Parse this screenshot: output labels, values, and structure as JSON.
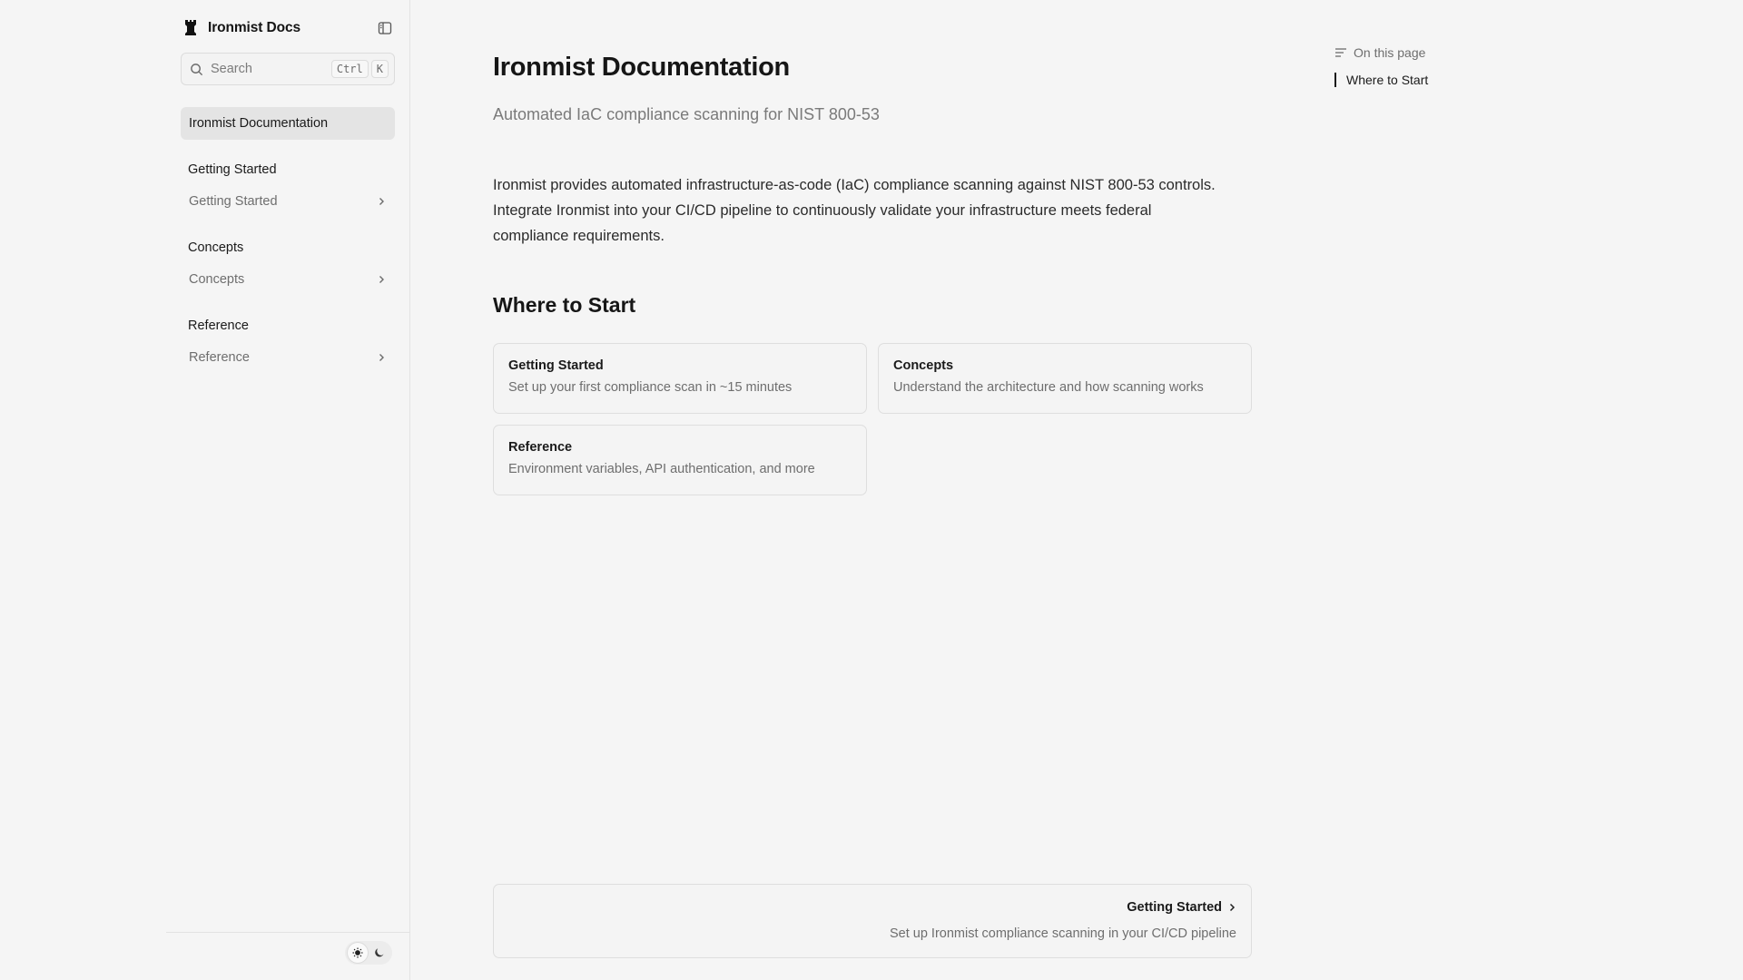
{
  "sidebar": {
    "site_title": "Ironmist Docs",
    "search": {
      "placeholder": "Search",
      "shortcut_ctrl": "Ctrl",
      "shortcut_key": "K"
    },
    "active_item": "Ironmist Documentation",
    "sections": [
      {
        "heading": "Getting Started",
        "item": "Getting Started"
      },
      {
        "heading": "Concepts",
        "item": "Concepts"
      },
      {
        "heading": "Reference",
        "item": "Reference"
      }
    ]
  },
  "main": {
    "title": "Ironmist Documentation",
    "subtitle": "Automated IaC compliance scanning for NIST 800-53",
    "intro_lines": [
      "Ironmist provides automated infrastructure-as-code (IaC) compliance scanning against NIST 800-53 controls.",
      "Integrate Ironmist into your CI/CD pipeline to continuously validate your infrastructure meets federal",
      "compliance requirements."
    ],
    "section_heading": "Where to Start",
    "cards": [
      {
        "title": "Getting Started",
        "description": "Set up your first compliance scan in ~15 minutes"
      },
      {
        "title": "Concepts",
        "description": "Understand the architecture and how scanning works"
      },
      {
        "title": "Reference",
        "description": "Environment variables, API authentication, and more"
      }
    ],
    "next": {
      "title": "Getting Started",
      "description": "Set up Ironmist compliance scanning in your CI/CD pipeline"
    }
  },
  "toc": {
    "header": "On this page",
    "items": [
      "Where to Start"
    ]
  },
  "icons": {
    "logo": "chess-rook-icon",
    "collapse": "sidebar-panel-icon",
    "search": "search-icon",
    "chevron": "chevron-right-icon",
    "theme_light": "sun-icon",
    "theme_dark": "moon-icon",
    "toc": "list-icon"
  },
  "colors": {
    "background": "#f5f5f5",
    "active_nav": "#e4e4e4",
    "border": "#dedede",
    "muted_text": "#6e6e6e",
    "text": "#1a1a1a"
  }
}
